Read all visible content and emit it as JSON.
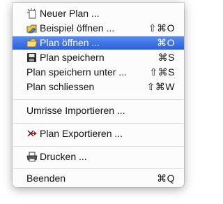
{
  "menu": {
    "items": [
      {
        "label": "Neuer Plan ...",
        "shortcut": "",
        "icon": "new-plan-icon"
      },
      {
        "label": "Beispiel öffnen ...",
        "shortcut": "⇧⌘O",
        "icon": "open-example-icon"
      },
      {
        "label": "Plan öffnen ...",
        "shortcut": "⌘O",
        "icon": "open-folder-icon"
      },
      {
        "label": "Plan speichern",
        "shortcut": "⌘S",
        "icon": "floppy-disk-icon"
      },
      {
        "label": "Plan speichern unter ...",
        "shortcut": "⇧⌘S",
        "icon": ""
      },
      {
        "label": "Plan schliessen",
        "shortcut": "⇧⌘W",
        "icon": ""
      },
      {
        "label": "Umrisse Importieren ...",
        "shortcut": "",
        "icon": ""
      },
      {
        "label": "Plan Exportieren ...",
        "shortcut": "",
        "icon": "export-arrow-icon"
      },
      {
        "label": "Drucken ...",
        "shortcut": "",
        "icon": "printer-icon"
      },
      {
        "label": "Beenden",
        "shortcut": "⌘Q",
        "icon": ""
      }
    ],
    "selected_index": 2,
    "highlight_color": "#3b72e6"
  }
}
